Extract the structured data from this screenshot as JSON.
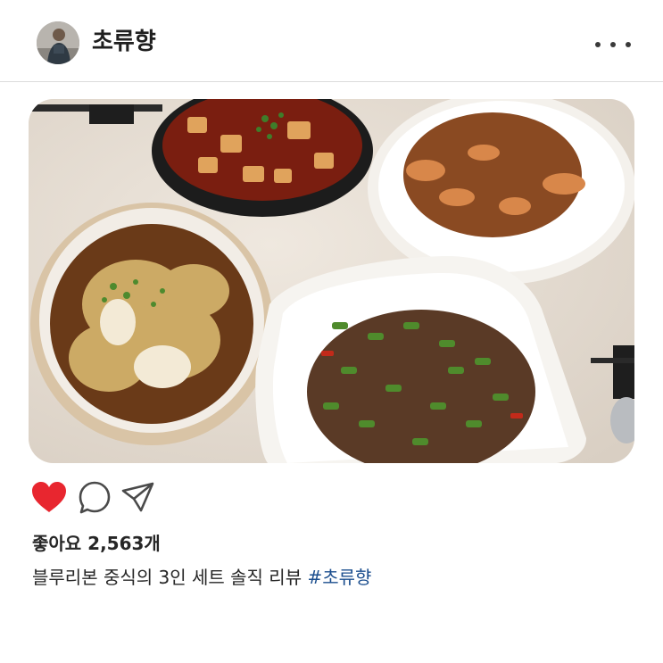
{
  "post": {
    "username": "초류향",
    "likes_text": "좋아요 2,563개",
    "caption_text": "블루리본 중식의 3인 세트 솔직 리뷰 ",
    "hashtag": "#초류향",
    "liked": true
  },
  "icons": {
    "more": "more-options-icon",
    "like": "heart-icon",
    "comment": "comment-bubble-icon",
    "share": "paper-plane-icon"
  },
  "colors": {
    "heart": "#e8262f",
    "hashtag": "#1b4e8e",
    "text": "#262626",
    "divider": "#dcdcdc"
  }
}
